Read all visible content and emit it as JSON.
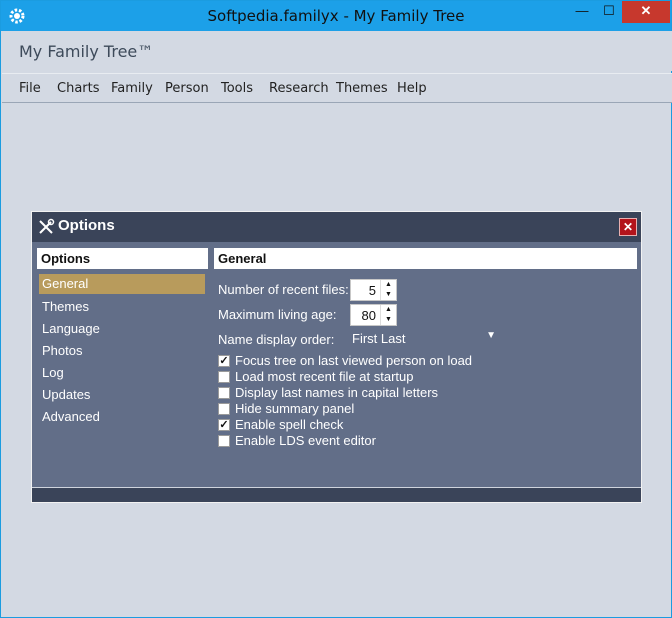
{
  "window": {
    "title": "Softpedia.familyx - My Family Tree",
    "min_glyph": "—",
    "max_glyph": "☐",
    "close_glyph": "✕",
    "app_icon": "gear-icon"
  },
  "app": {
    "brand": "My Family Tree™"
  },
  "menu": [
    "File",
    "Charts",
    "Family",
    "Person",
    "Tools",
    "Research",
    "Themes",
    "Help"
  ],
  "dialog": {
    "title": "Options",
    "title_icon": "tools-icon",
    "close_glyph": "✕",
    "left_header": "Options",
    "right_header": "General",
    "nav": [
      "General",
      "Themes",
      "Language",
      "Photos",
      "Log",
      "Updates",
      "Advanced"
    ],
    "active_nav": "General",
    "fields": {
      "recent_files_label": "Number of recent files:",
      "recent_files_value": "5",
      "living_age_label": "Maximum living age:",
      "living_age_value": "80",
      "name_order_label": "Name display order:",
      "name_order_value": "First Last"
    },
    "checkboxes": [
      {
        "label": "Focus tree on last viewed person on load",
        "checked": true
      },
      {
        "label": "Load most recent file at startup",
        "checked": false
      },
      {
        "label": "Display last names in capital letters",
        "checked": false
      },
      {
        "label": "Hide summary panel",
        "checked": false
      },
      {
        "label": "Enable spell check",
        "checked": true
      },
      {
        "label": "Enable LDS event editor",
        "checked": false
      }
    ]
  },
  "colors": {
    "titlebar": "#1ca0e8",
    "dialog_bg": "#626e88",
    "dialog_header": "#3a4459",
    "active_nav": "#b89b5c",
    "close_red": "#b3141b"
  }
}
